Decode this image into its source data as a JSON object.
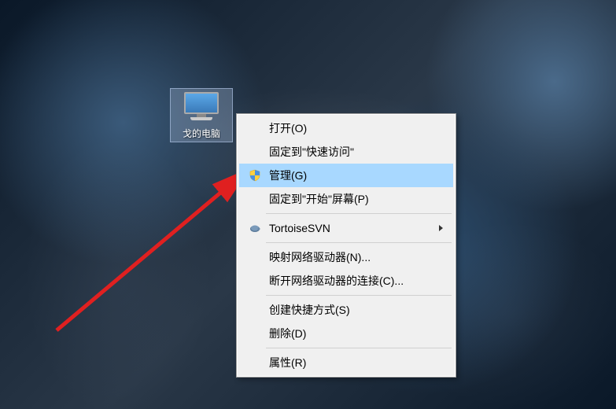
{
  "desktop": {
    "icon_label": "戈的电脑"
  },
  "context_menu": {
    "items": [
      {
        "label": "打开(O)",
        "icon": null,
        "submenu": false
      },
      {
        "label": "固定到\"快速访问\"",
        "icon": null,
        "submenu": false
      },
      {
        "label": "管理(G)",
        "icon": "shield",
        "submenu": false,
        "highlighted": true
      },
      {
        "label": "固定到\"开始\"屏幕(P)",
        "icon": null,
        "submenu": false
      }
    ],
    "group2": [
      {
        "label": "TortoiseSVN",
        "icon": "tortoise",
        "submenu": true
      }
    ],
    "group3": [
      {
        "label": "映射网络驱动器(N)...",
        "icon": null,
        "submenu": false
      },
      {
        "label": "断开网络驱动器的连接(C)...",
        "icon": null,
        "submenu": false
      }
    ],
    "group4": [
      {
        "label": "创建快捷方式(S)",
        "icon": null,
        "submenu": false
      },
      {
        "label": "删除(D)",
        "icon": null,
        "submenu": false
      }
    ],
    "group5": [
      {
        "label": "属性(R)",
        "icon": null,
        "submenu": false
      }
    ]
  }
}
